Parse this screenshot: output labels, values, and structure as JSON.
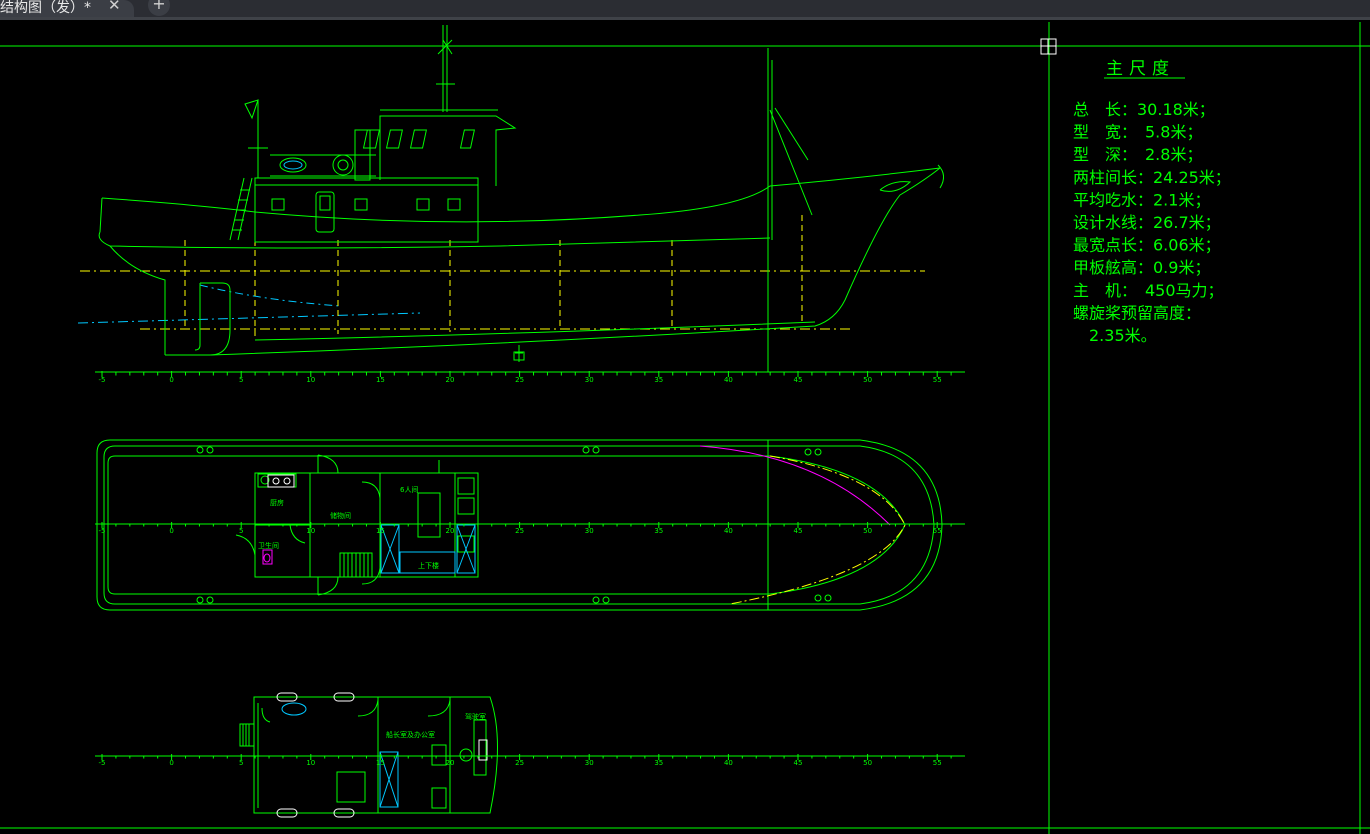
{
  "tab": {
    "title": "结构图（发）*",
    "close_glyph": "✕",
    "add_glyph": "+"
  },
  "spec": {
    "heading": "主尺度",
    "lines": [
      "总　长：30.18米；",
      "型　宽：　5.8米；",
      "型　深：　2.8米；",
      "两柱间长：24.25米；",
      "平均吃水：2.1米；",
      "设计水线：26.7米；",
      "最宽点长：6.06米；",
      "甲板舷高：0.9米；",
      "主　机：　450马力；",
      "螺旋桨预留高度：",
      "　2.35米。"
    ]
  },
  "scale": {
    "labels": [
      "-5",
      "0",
      "5",
      "10",
      "15",
      "20",
      "25",
      "30",
      "35",
      "40",
      "45",
      "50",
      "55"
    ]
  },
  "main_deck": {
    "galley": "厨房",
    "store": "储物间",
    "toilet": "卫生间",
    "crew": "6人间",
    "stair": "上下楼"
  },
  "upper_deck": {
    "office": "船长室及办公室",
    "wheelhouse": "驾驶室"
  },
  "colors": {
    "green": "#00ff00",
    "yellow": "#ffff00",
    "cyan": "#00c8ff",
    "magenta": "#ff00ff",
    "white": "#ffffff"
  }
}
